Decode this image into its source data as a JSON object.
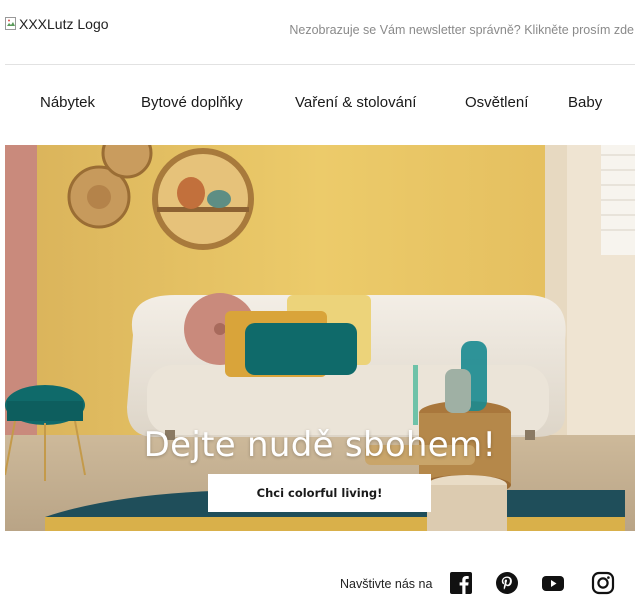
{
  "header": {
    "logo_alt": "XXXLutz Logo",
    "view_in_browser": "Nezobrazuje se Vám newsletter správně? Klikněte prosím zde"
  },
  "nav": {
    "items": [
      {
        "label": "Nábytek"
      },
      {
        "label": "Bytové doplňky"
      },
      {
        "label": "Vaření & stolování"
      },
      {
        "label": "Osvětlení"
      },
      {
        "label": "Baby"
      }
    ]
  },
  "hero": {
    "headline": "Dejte nudě sbohem!",
    "cta_label": "Chci colorful living!"
  },
  "social": {
    "label": "Navštivte nás na",
    "icons": [
      "facebook-icon",
      "pinterest-icon",
      "youtube-icon",
      "instagram-icon"
    ]
  },
  "colors": {
    "wall": "#e8c25a",
    "sofa": "#ece6dc",
    "teal": "#0f6a6a",
    "mustard": "#d9a43a",
    "pink": "#c98a7c"
  }
}
